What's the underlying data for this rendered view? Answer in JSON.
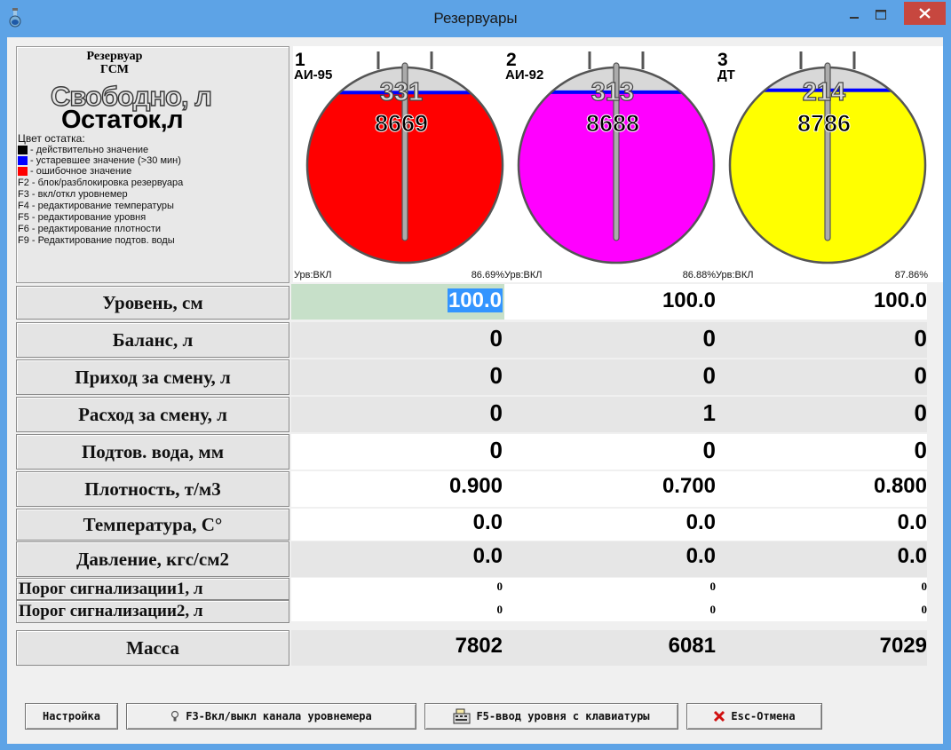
{
  "window": {
    "title": "Резервуары"
  },
  "legend": {
    "title_line1": "Резервуар",
    "title_line2": "ГСМ",
    "free_label": "Свободно, л",
    "rest_label": "Остаток,л",
    "color_heading": "Цвет остатка:",
    "items": [
      {
        "color": "#000000",
        "text": "- действительно значение"
      },
      {
        "color": "#0000ff",
        "text": "- устаревшее значение (>30 мин)"
      },
      {
        "color": "#ff0000",
        "text": "- ошибочное значение"
      }
    ],
    "hotkeys": [
      "F2 - блок/разблокировка резервуара",
      "F3 - вкл/откл уровнемер",
      "F4 - редактирование температуры",
      "F5 - редактирование уровня",
      "F6 - редактирование плотности",
      "F9 - Редактирование подтов. воды"
    ]
  },
  "tanks": [
    {
      "number": "1",
      "fuel": "АИ-95",
      "free": "331",
      "rest": "8669",
      "status": "Урв:ВКЛ",
      "percent": "86.69%",
      "fill_fraction": 0.8669,
      "color": "#ff0000"
    },
    {
      "number": "2",
      "fuel": "АИ-92",
      "free": "313",
      "rest": "8688",
      "status": "Урв:ВКЛ",
      "percent": "86.88%",
      "fill_fraction": 0.8688,
      "color": "#ff00ff"
    },
    {
      "number": "3",
      "fuel": "ДТ",
      "free": "214",
      "rest": "8786",
      "status": "Урв:ВКЛ",
      "percent": "87.86%",
      "fill_fraction": 0.8786,
      "color": "#ffff00"
    }
  ],
  "rows": [
    {
      "label": "Уровень, см",
      "values": [
        "100.0",
        "100.0",
        "100.0"
      ]
    },
    {
      "label": "Баланс, л",
      "values": [
        "0",
        "0",
        "0"
      ]
    },
    {
      "label": "Приход за смену, л",
      "values": [
        "0",
        "0",
        "0"
      ]
    },
    {
      "label": "Расход за смену, л",
      "values": [
        "0",
        "1",
        "0"
      ]
    },
    {
      "label": "Подтов. вода, мм",
      "values": [
        "0",
        "0",
        "0"
      ]
    },
    {
      "label": "Плотность, т/м3",
      "values": [
        "0.900",
        "0.700",
        "0.800"
      ]
    },
    {
      "label": "Температура, С°",
      "values": [
        "0.0",
        "0.0",
        "0.0"
      ]
    },
    {
      "label": "Давление, кгс/см2",
      "values": [
        "0.0",
        "0.0",
        "0.0"
      ]
    },
    {
      "label": "Порог сигнализации1, л",
      "values": [
        "0",
        "0",
        "0"
      ]
    },
    {
      "label": "Порог сигнализации2, л",
      "values": [
        "0",
        "0",
        "0"
      ]
    },
    {
      "label": "Масса",
      "values": [
        "7802",
        "6081",
        "7029"
      ]
    }
  ],
  "buttons": {
    "settings": "Настройка",
    "f3": "F3-Вкл/выкл канала уровнемера",
    "f5": "F5-ввод уровня с клавиатуры",
    "esc": "Esc-Отмена"
  },
  "icons": {
    "f3": "lightbulb-icon",
    "f5": "keyboard-icon",
    "esc": "red-x-icon",
    "app": "flask-icon"
  }
}
